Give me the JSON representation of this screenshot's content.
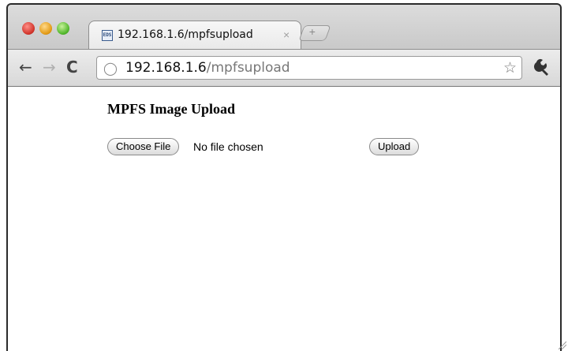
{
  "browser": {
    "tab": {
      "title": "192.168.1.6/mpfsupload",
      "close_glyph": "×",
      "favicon_text": "EDS"
    },
    "new_tab_glyph": "+",
    "url": {
      "host": "192.168.1.6",
      "path": "/mpfsupload"
    },
    "icons": [
      "back-arrow-icon",
      "forward-arrow-icon",
      "reload-icon",
      "globe-icon",
      "star-icon",
      "wrench-icon"
    ]
  },
  "page": {
    "heading": "MPFS Image Upload",
    "file_button_label": "Choose File",
    "file_status": "No file chosen",
    "upload_button_label": "Upload"
  }
}
